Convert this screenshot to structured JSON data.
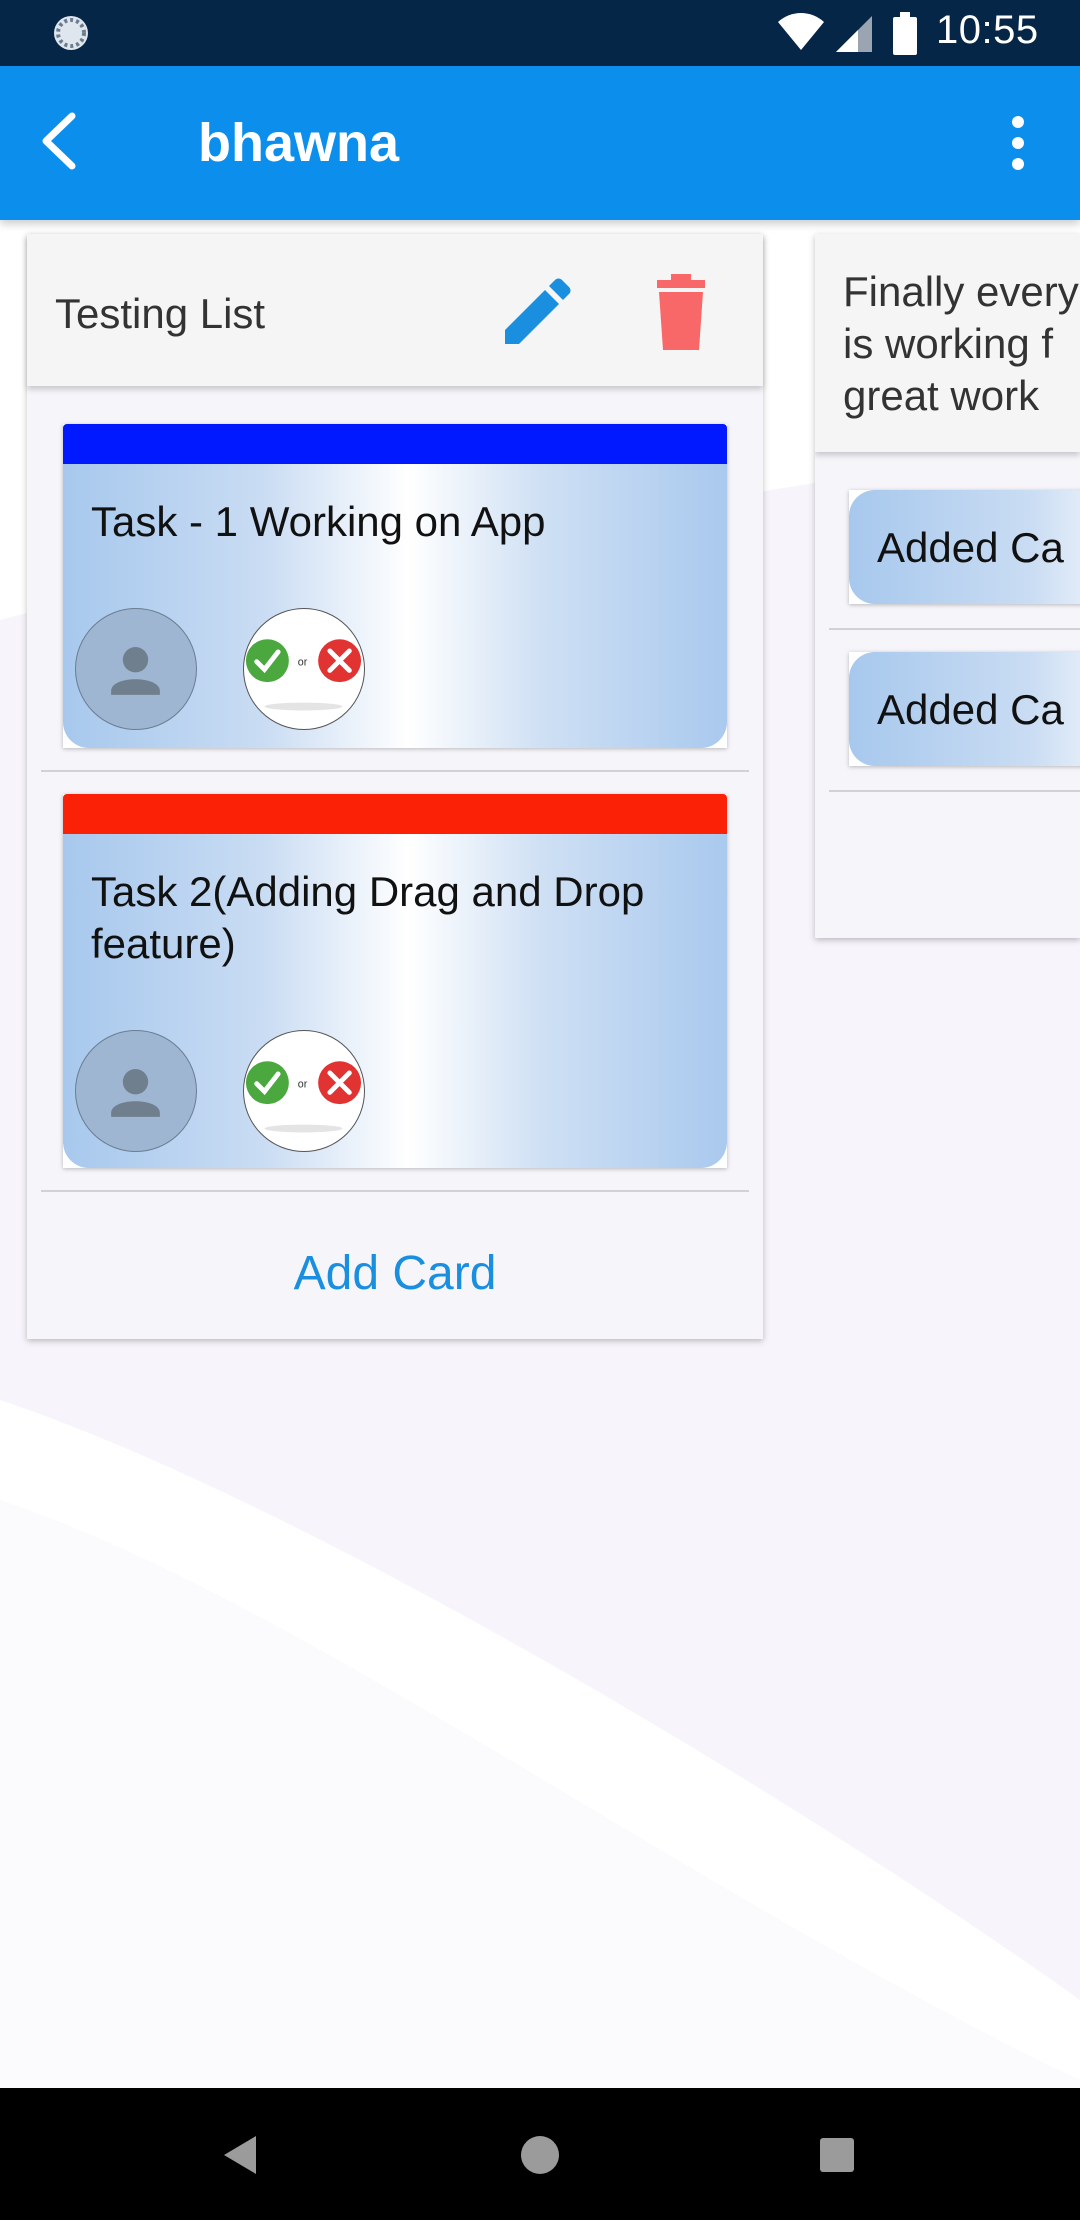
{
  "status_bar": {
    "time": "10:55",
    "icons": [
      "sync-icon",
      "wifi-icon",
      "signal-icon",
      "battery-icon"
    ]
  },
  "app_bar": {
    "title": "bhawna",
    "back_icon": "back-arrow-icon",
    "menu_icon": "more-vertical-icon",
    "color": "#0c8fec"
  },
  "lists": [
    {
      "title": "Testing List",
      "actions": [
        "edit-icon",
        "delete-icon"
      ],
      "cards": [
        {
          "stripe_color": "#0019ff",
          "title": "Task - 1 Working on App"
        },
        {
          "stripe_color": "#fa2106",
          "title": "Task 2(Adding Drag and Drop feature)"
        }
      ],
      "add_card_label": "Add Card"
    },
    {
      "title": "Finally every​\nis working f\ngreat work",
      "title_lines": [
        "Finally every",
        "is working f",
        "great work"
      ],
      "cards": [
        {
          "title": "Added Ca"
        },
        {
          "title": "Added Ca"
        }
      ]
    }
  ],
  "approve_badge_text": "or",
  "nav_bar": {
    "buttons": [
      "back-nav-icon",
      "home-nav-icon",
      "recents-nav-icon"
    ]
  },
  "colors": {
    "status_bar": "#052646",
    "accent": "#1a8fe0",
    "delete": "#f86868",
    "edit": "#1a8fe0"
  }
}
